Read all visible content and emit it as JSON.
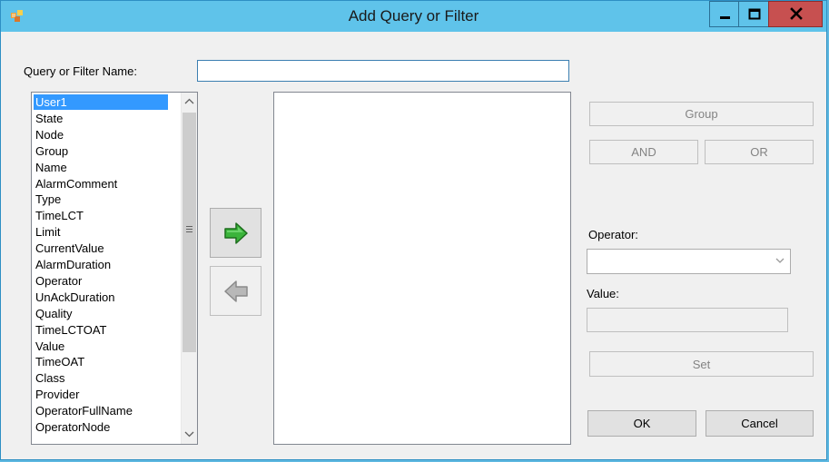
{
  "window": {
    "title": "Add Query or Filter",
    "title_color": "#5fc3ea",
    "close_color": "#c75050",
    "icons": [
      "app-icon",
      "minimize-icon",
      "maximize-icon",
      "close-icon"
    ]
  },
  "form": {
    "name_label": "Query or Filter Name:",
    "name_value": "",
    "fields": [
      "User1",
      "State",
      "Node",
      "Group",
      "Name",
      "AlarmComment",
      "Type",
      "TimeLCT",
      "Limit",
      "CurrentValue",
      "AlarmDuration",
      "Operator",
      "UnAckDuration",
      "Quality",
      "TimeLCTOAT",
      "Value",
      "TimeOAT",
      "Class",
      "Provider",
      "OperatorFullName",
      "OperatorNode"
    ],
    "selected_field": "User1",
    "add_icon": "green-right-arrow-icon",
    "remove_icon": "gray-left-arrow-icon"
  },
  "buttons": {
    "group": "Group",
    "and": "AND",
    "or": "OR",
    "set": "Set",
    "ok": "OK",
    "cancel": "Cancel"
  },
  "operator": {
    "label": "Operator:",
    "selected": ""
  },
  "value": {
    "label": "Value:",
    "text": ""
  }
}
